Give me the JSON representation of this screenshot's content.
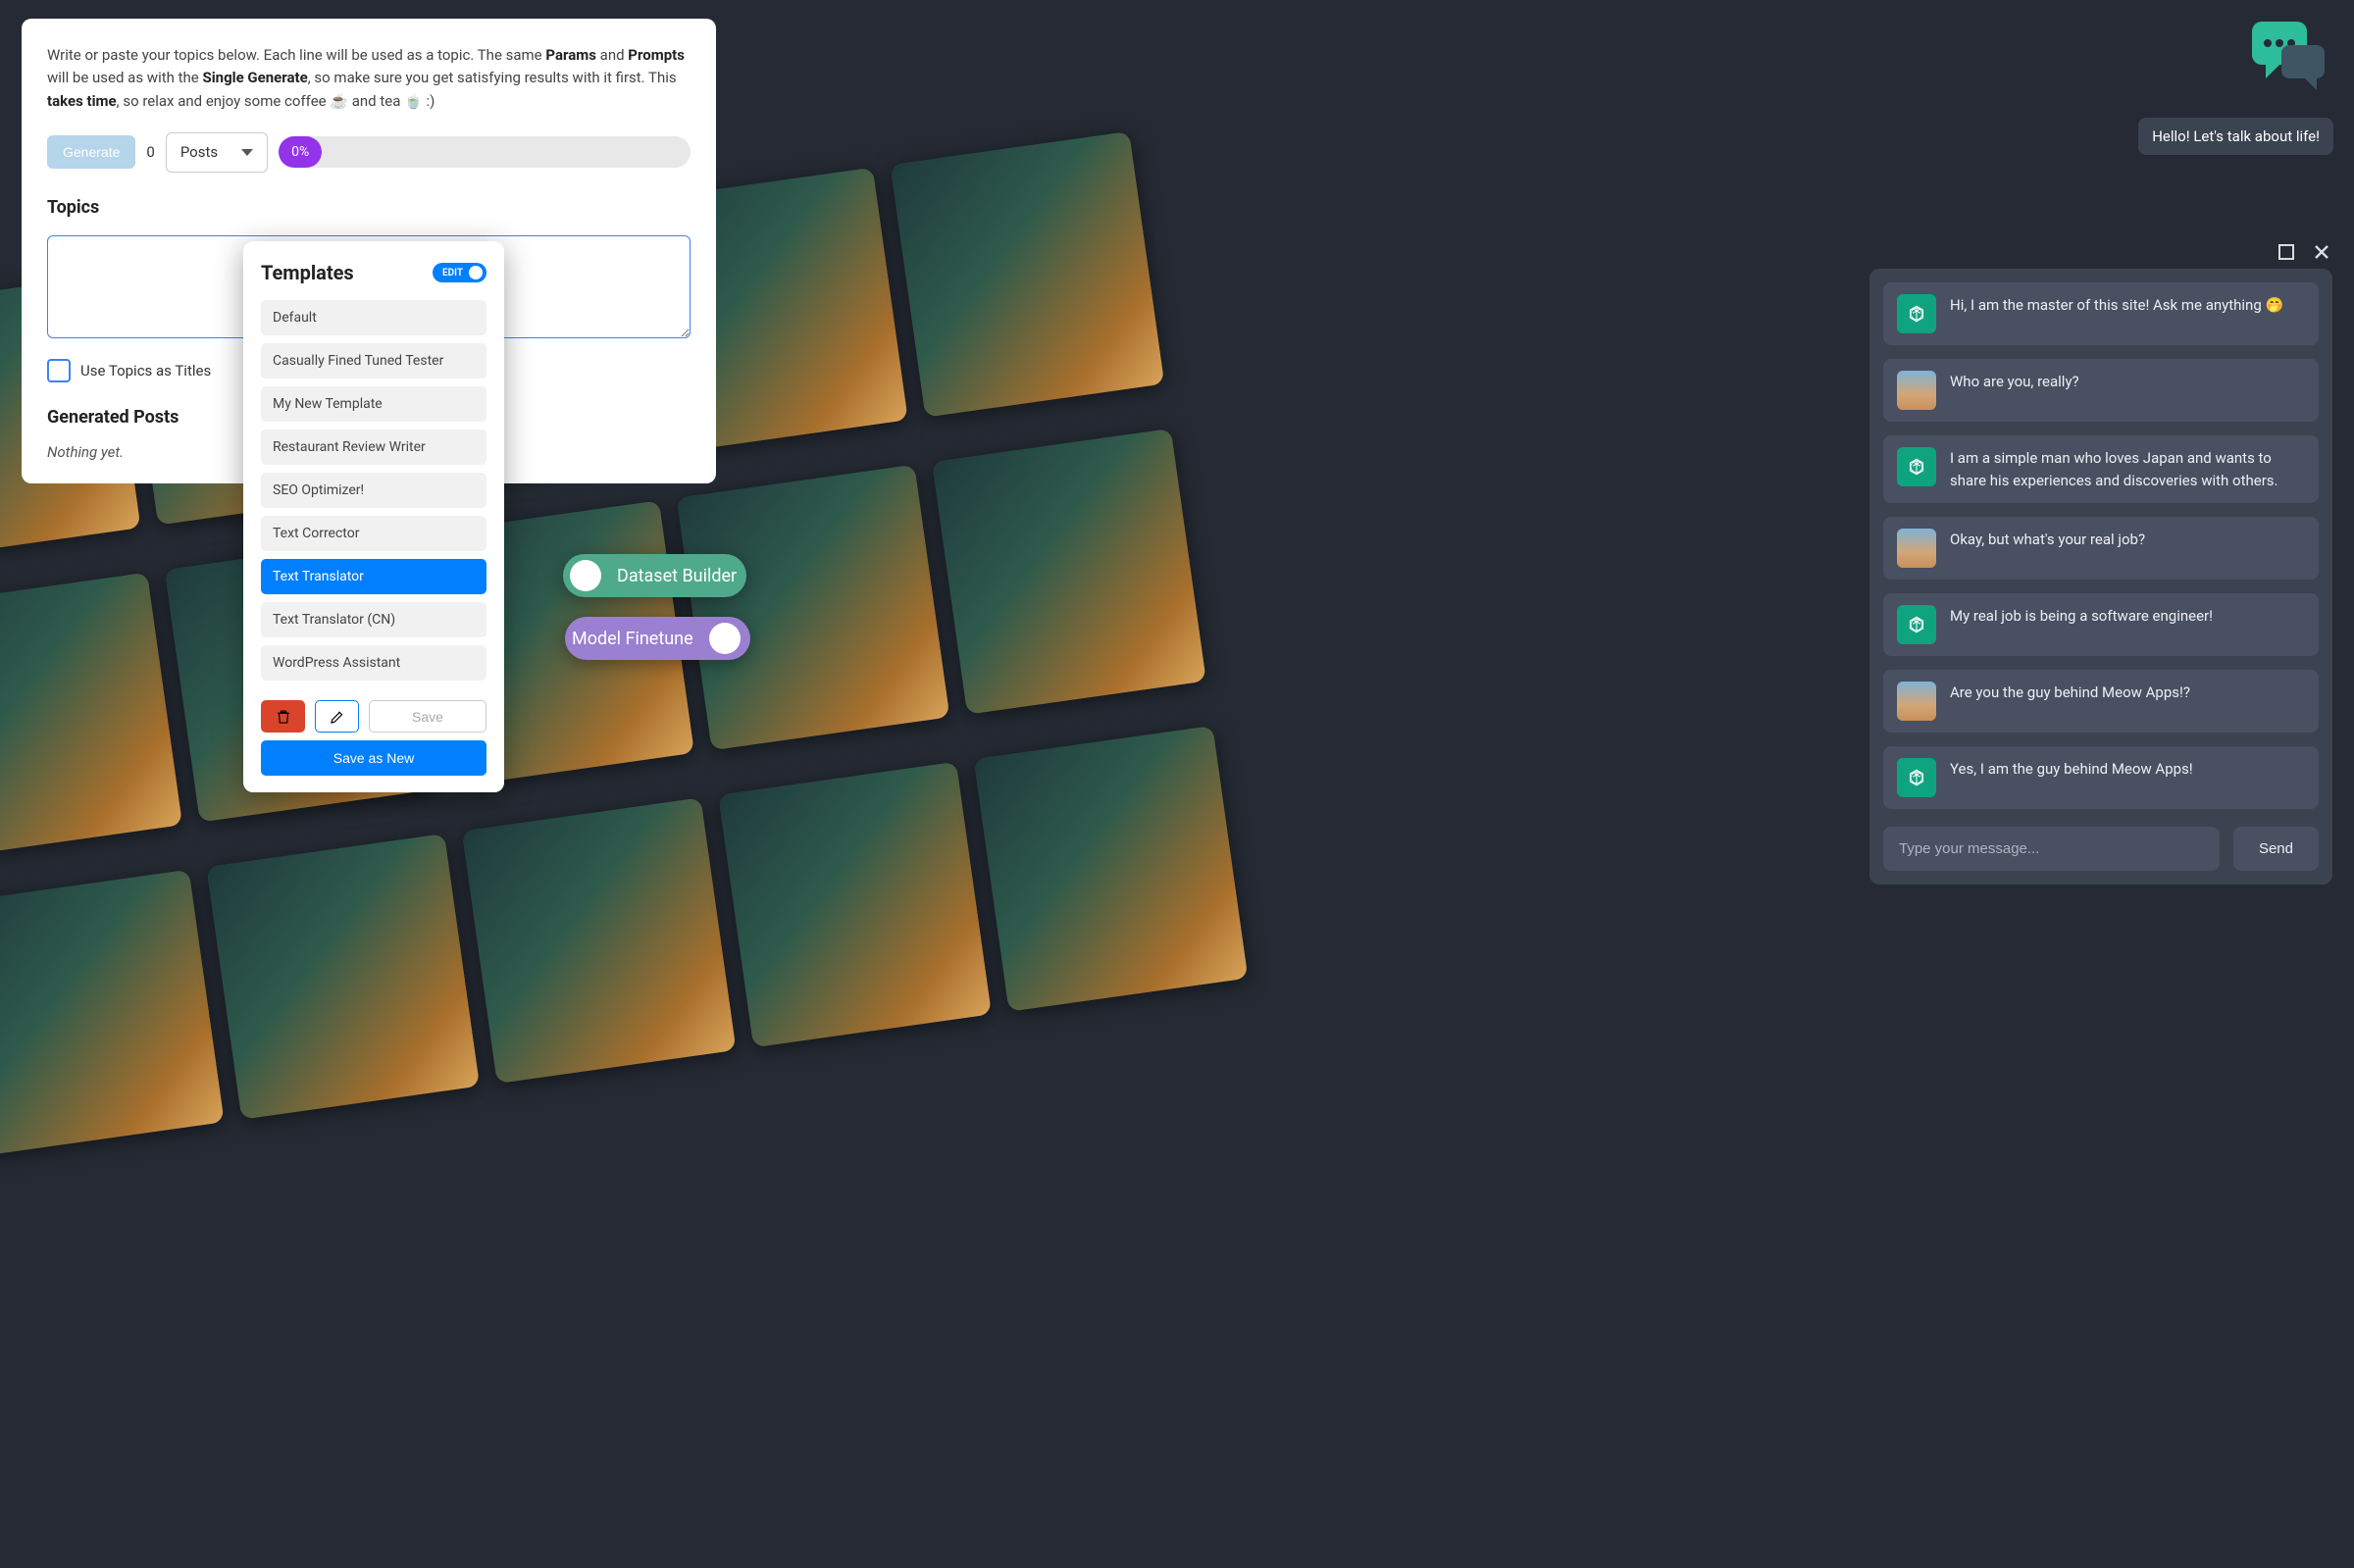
{
  "bulk": {
    "desc_parts": {
      "t1": "Write or paste your topics below. Each line will be used as a topic. The same ",
      "b1": "Params",
      "t2": " and ",
      "b2": "Prompts",
      "t3": " will be used as with the ",
      "b3": "Single Generate",
      "t4": ", so make sure you get satisfying results with it first. This ",
      "b4": "takes time",
      "t5": ", so relax and enjoy some coffee ☕ and tea 🍵 :)"
    },
    "generate_label": "Generate",
    "count": "0",
    "select_value": "Posts",
    "progress_label": "0%",
    "topics_heading": "Topics",
    "use_titles_label": "Use Topics as Titles",
    "generated_heading": "Generated Posts",
    "nothing_yet": "Nothing yet."
  },
  "templates": {
    "heading": "Templates",
    "edit_label": "EDIT",
    "items": [
      {
        "label": "Default"
      },
      {
        "label": "Casually Fined Tuned Tester"
      },
      {
        "label": "My New Template"
      },
      {
        "label": "Restaurant Review Writer"
      },
      {
        "label": "SEO Optimizer!"
      },
      {
        "label": "Text Corrector"
      },
      {
        "label": "Text Translator"
      },
      {
        "label": "Text Translator (CN)"
      },
      {
        "label": "WordPress Assistant"
      }
    ],
    "active_index": 6,
    "save_label": "Save",
    "save_as_new_label": "Save as New"
  },
  "pills": {
    "dataset": "Dataset Builder",
    "finetune": "Model Finetune"
  },
  "hello": "Hello! Let's talk about life!",
  "chat": {
    "input_placeholder": "Type your message...",
    "send_label": "Send",
    "messages": [
      {
        "role": "ai",
        "text": "Hi, I am the master of this site! Ask me anything 🤭"
      },
      {
        "role": "user",
        "text": "Who are you, really?"
      },
      {
        "role": "ai",
        "text": "I am a simple man who loves Japan and wants to share his experiences and discoveries with others."
      },
      {
        "role": "user",
        "text": "Okay, but what's your real job?"
      },
      {
        "role": "ai",
        "text": "My real job is being a software engineer!"
      },
      {
        "role": "user",
        "text": "Are you the guy behind Meow Apps!?"
      },
      {
        "role": "ai",
        "text": "Yes, I am the guy behind Meow Apps!"
      }
    ]
  }
}
